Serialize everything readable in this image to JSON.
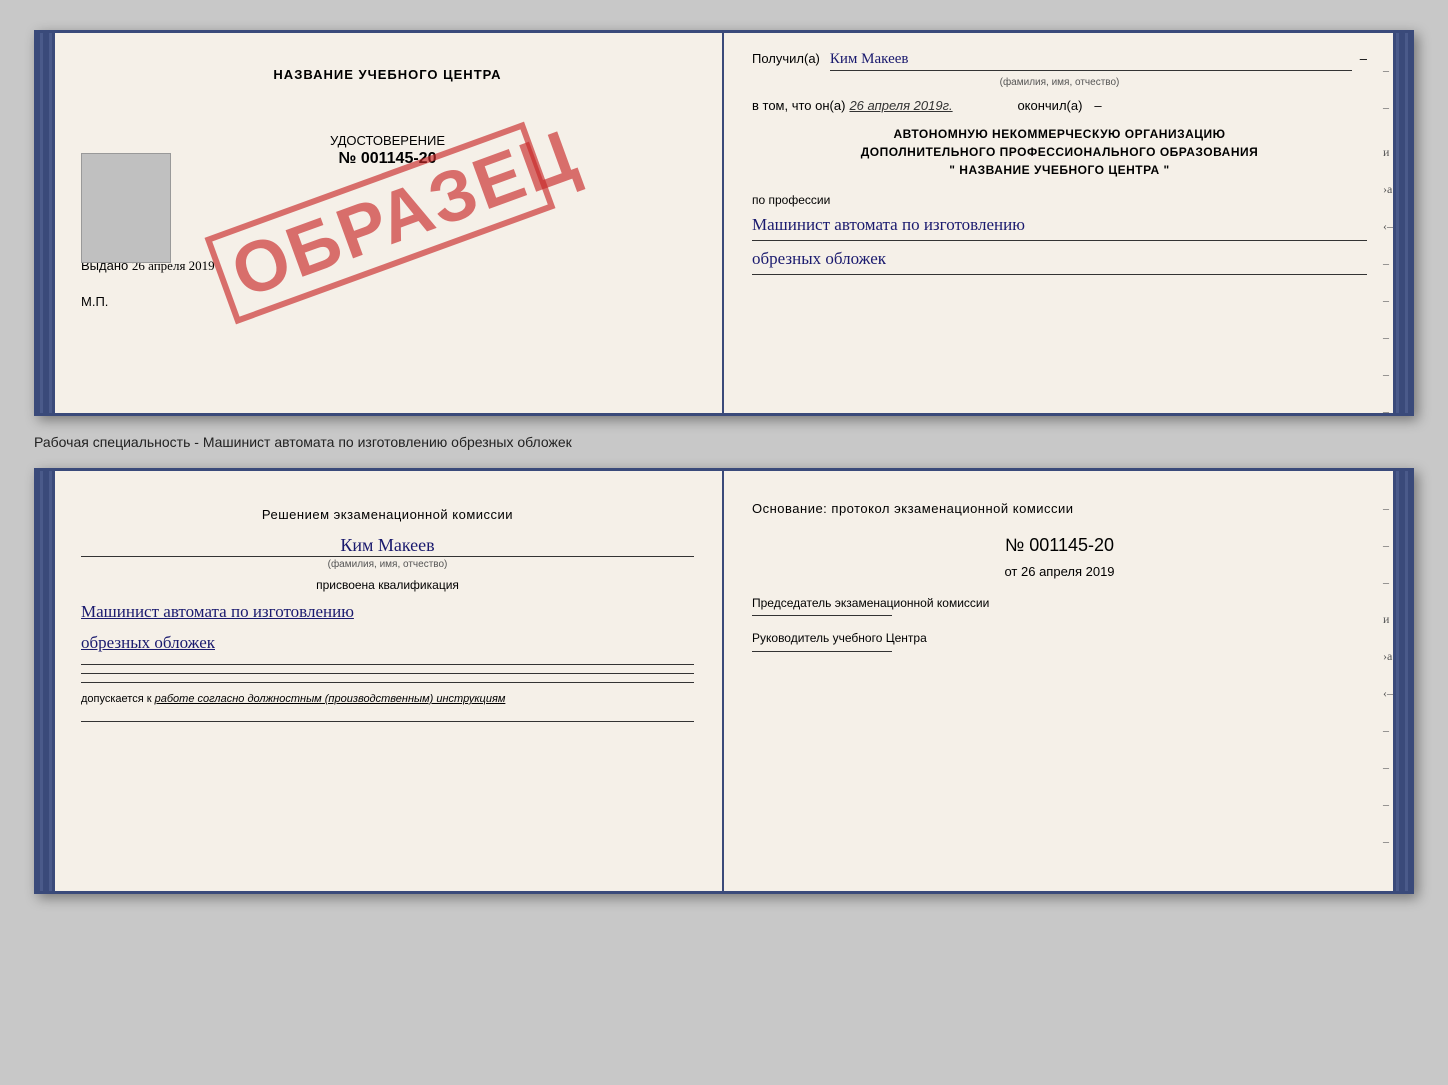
{
  "top_doc": {
    "left": {
      "title": "НАЗВАНИЕ УЧЕБНОГО ЦЕНТРА",
      "certificate_label": "УДОСТОВЕРЕНИЕ",
      "number_prefix": "№",
      "number": "001145-20",
      "issued_label": "Выдано",
      "issued_date": "26 апреля 2019",
      "mp_label": "М.П.",
      "stamp_text": "ОБРАЗЕЦ"
    },
    "right": {
      "received_label": "Получил(а)",
      "name": "Ким Макеев",
      "name_sub": "(фамилия, имя, отчество)",
      "in_that_label": "в том, что он(а)",
      "date_value": "26 апреля 2019г.",
      "finished_label": "окончил(а)",
      "org_line1": "АВТОНОМНУЮ НЕКОММЕРЧЕСКУЮ ОРГАНИЗАЦИЮ",
      "org_line2": "ДОПОЛНИТЕЛЬНОГО ПРОФЕССИОНАЛЬНОГО ОБРАЗОВАНИЯ",
      "org_line3": "\"  НАЗВАНИЕ УЧЕБНОГО ЦЕНТРА  \"",
      "profession_label": "по профессии",
      "profession_line1": "Машинист автомата по изготовлению",
      "profession_line2": "обрезных обложек"
    }
  },
  "description": "Рабочая специальность - Машинист автомата по изготовлению обрезных обложек",
  "bottom_doc": {
    "left": {
      "decision_label": "Решением экзаменационной комиссии",
      "name": "Ким Макеев",
      "name_sub": "(фамилия, имя, отчество)",
      "assigned_label": "присвоена квалификация",
      "profession_line1": "Машинист автомата по изготовлению",
      "profession_line2": "обрезных обложек",
      "dopusk_text": "допускается к",
      "dopusk_italic": "работе согласно должностным (производственным) инструкциям"
    },
    "right": {
      "basis_label": "Основание: протокол экзаменационной комиссии",
      "number_prefix": "№",
      "number": "001145-20",
      "date_prefix": "от",
      "date": "26 апреля 2019",
      "chairman_label": "Председатель экзаменационной комиссии",
      "head_label": "Руководитель учебного Центра"
    }
  }
}
